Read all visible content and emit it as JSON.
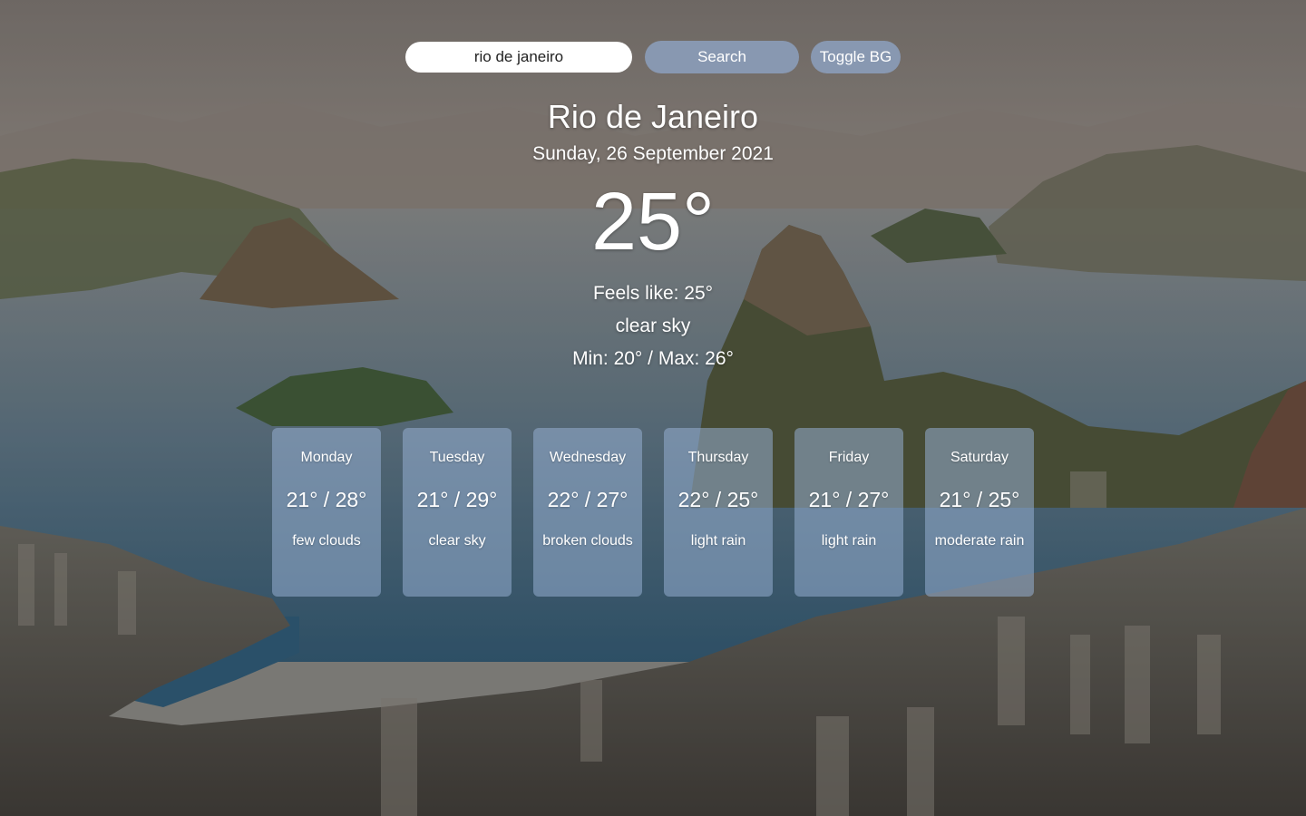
{
  "search": {
    "value": "rio de janeiro",
    "button_label": "Search",
    "toggle_label": "Toggle BG"
  },
  "current": {
    "city": "Rio de Janeiro",
    "date": "Sunday, 26 September 2021",
    "temperature": "25°",
    "feels_like": "Feels like: 25°",
    "description": "clear sky",
    "min_max": "Min: 20° / Max: 26°"
  },
  "forecast": [
    {
      "day": "Monday",
      "temp": "21° / 28°",
      "desc": "few clouds"
    },
    {
      "day": "Tuesday",
      "temp": "21° / 29°",
      "desc": "clear sky"
    },
    {
      "day": "Wednesday",
      "temp": "22° / 27°",
      "desc": "broken clouds"
    },
    {
      "day": "Thursday",
      "temp": "22° / 25°",
      "desc": "light rain"
    },
    {
      "day": "Friday",
      "temp": "21° / 27°",
      "desc": "light rain"
    },
    {
      "day": "Saturday",
      "temp": "21° / 25°",
      "desc": "moderate rain"
    }
  ],
  "colors": {
    "card_background": "#96afd2",
    "button_background": "#8ca0be",
    "text": "#ffffff"
  }
}
